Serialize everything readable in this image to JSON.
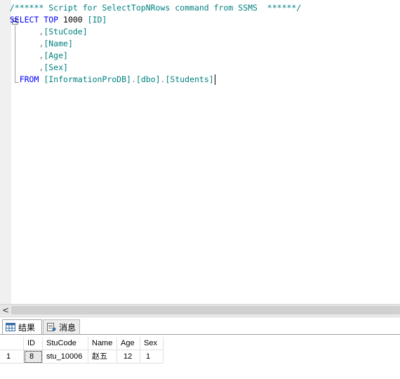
{
  "editor": {
    "lines": [
      [
        {
          "t": "comment",
          "v": "  /****** Script for SelectTopNRows command from SSMS  ******/"
        }
      ],
      [
        {
          "t": "kw",
          "v": "  SELECT TOP"
        },
        {
          "t": "plain",
          "v": " 1000 "
        },
        {
          "t": "ident",
          "v": "[ID]"
        }
      ],
      [
        {
          "t": "plain",
          "v": "        "
        },
        {
          "t": "gray",
          "v": ","
        },
        {
          "t": "ident",
          "v": "[StuCode]"
        }
      ],
      [
        {
          "t": "plain",
          "v": "        "
        },
        {
          "t": "gray",
          "v": ","
        },
        {
          "t": "ident",
          "v": "[Name]"
        }
      ],
      [
        {
          "t": "plain",
          "v": "        "
        },
        {
          "t": "gray",
          "v": ","
        },
        {
          "t": "ident",
          "v": "[Age]"
        }
      ],
      [
        {
          "t": "plain",
          "v": "        "
        },
        {
          "t": "gray",
          "v": ","
        },
        {
          "t": "ident",
          "v": "[Sex]"
        }
      ],
      [
        {
          "t": "kw",
          "v": "    FROM"
        },
        {
          "t": "plain",
          "v": " "
        },
        {
          "t": "ident",
          "v": "[InformationProDB]"
        },
        {
          "t": "gray",
          "v": "."
        },
        {
          "t": "ident",
          "v": "[dbo]"
        },
        {
          "t": "gray",
          "v": "."
        },
        {
          "t": "ident",
          "v": "[Students]"
        }
      ]
    ]
  },
  "scrollbar": {
    "left_arrow": "<"
  },
  "tabs": {
    "results_label": "结果",
    "messages_label": "消息",
    "results_icon": "grid-icon",
    "messages_icon": "message-icon"
  },
  "grid": {
    "columns": [
      "ID",
      "StuCode",
      "Name",
      "Age",
      "Sex"
    ],
    "rows": [
      {
        "row_number": "1",
        "cells": [
          "8",
          "stu_10006",
          "赵五",
          "12",
          "1"
        ]
      }
    ]
  },
  "colors": {
    "keyword": "#0000ff",
    "comment": "#008080",
    "identifier": "#008080",
    "operator": "#808080"
  }
}
